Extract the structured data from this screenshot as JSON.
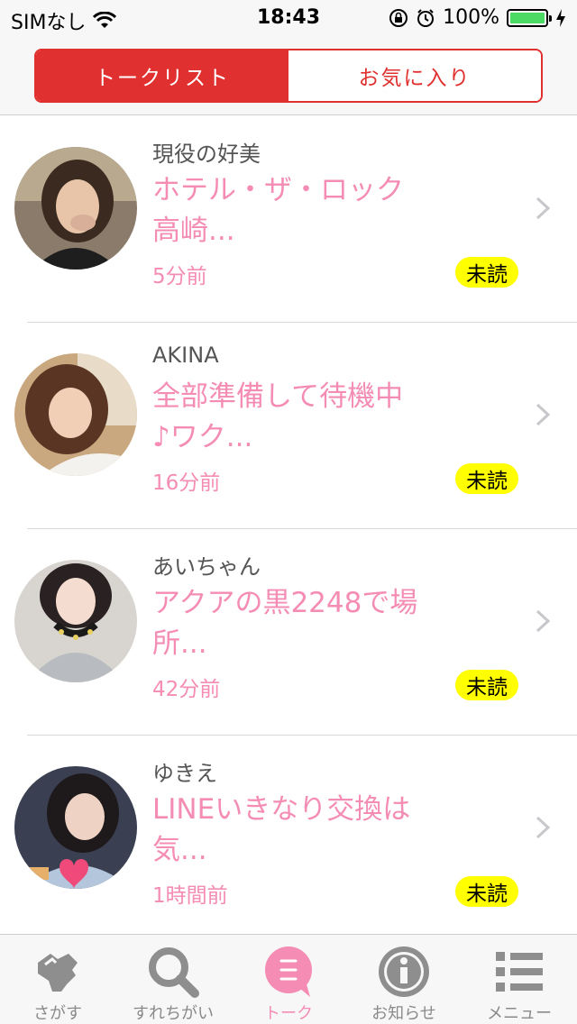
{
  "status_bar": {
    "carrier": "SIMなし",
    "time": "18:43",
    "battery": "100%"
  },
  "segment": {
    "tabs": [
      {
        "label": "トークリスト",
        "active": true
      },
      {
        "label": "お気に入り",
        "active": false
      }
    ]
  },
  "conversations": [
    {
      "name": "現役の好美",
      "message_line1": "ホテル・ザ・ロック",
      "message_line2": "高崎...",
      "time": "5分前",
      "badge": "未読"
    },
    {
      "name": "AKINA",
      "message_line1": "全部準備して待機中",
      "message_line2": "♪ワク...",
      "time": "16分前",
      "badge": "未読"
    },
    {
      "name": "あいちゃん",
      "message_line1": "アクアの黒2248で場",
      "message_line2": "所...",
      "time": "42分前",
      "badge": "未読"
    },
    {
      "name": "ゆきえ",
      "message_line1": "LINEいきなり交換は",
      "message_line2": "気...",
      "time": "1時間前",
      "badge": "未読"
    }
  ],
  "tabbar": {
    "items": [
      {
        "label": "さがす",
        "icon": "hand-tap-icon"
      },
      {
        "label": "すれちがい",
        "icon": "magnifier-icon"
      },
      {
        "label": "トーク",
        "icon": "chat-bubble-icon",
        "active": true
      },
      {
        "label": "お知らせ",
        "icon": "info-icon"
      },
      {
        "label": "メニュー",
        "icon": "menu-list-icon"
      }
    ]
  },
  "colors": {
    "accent_red": "#e0302f",
    "pink_text": "#f48cb4",
    "badge_yellow": "#ffff00"
  }
}
